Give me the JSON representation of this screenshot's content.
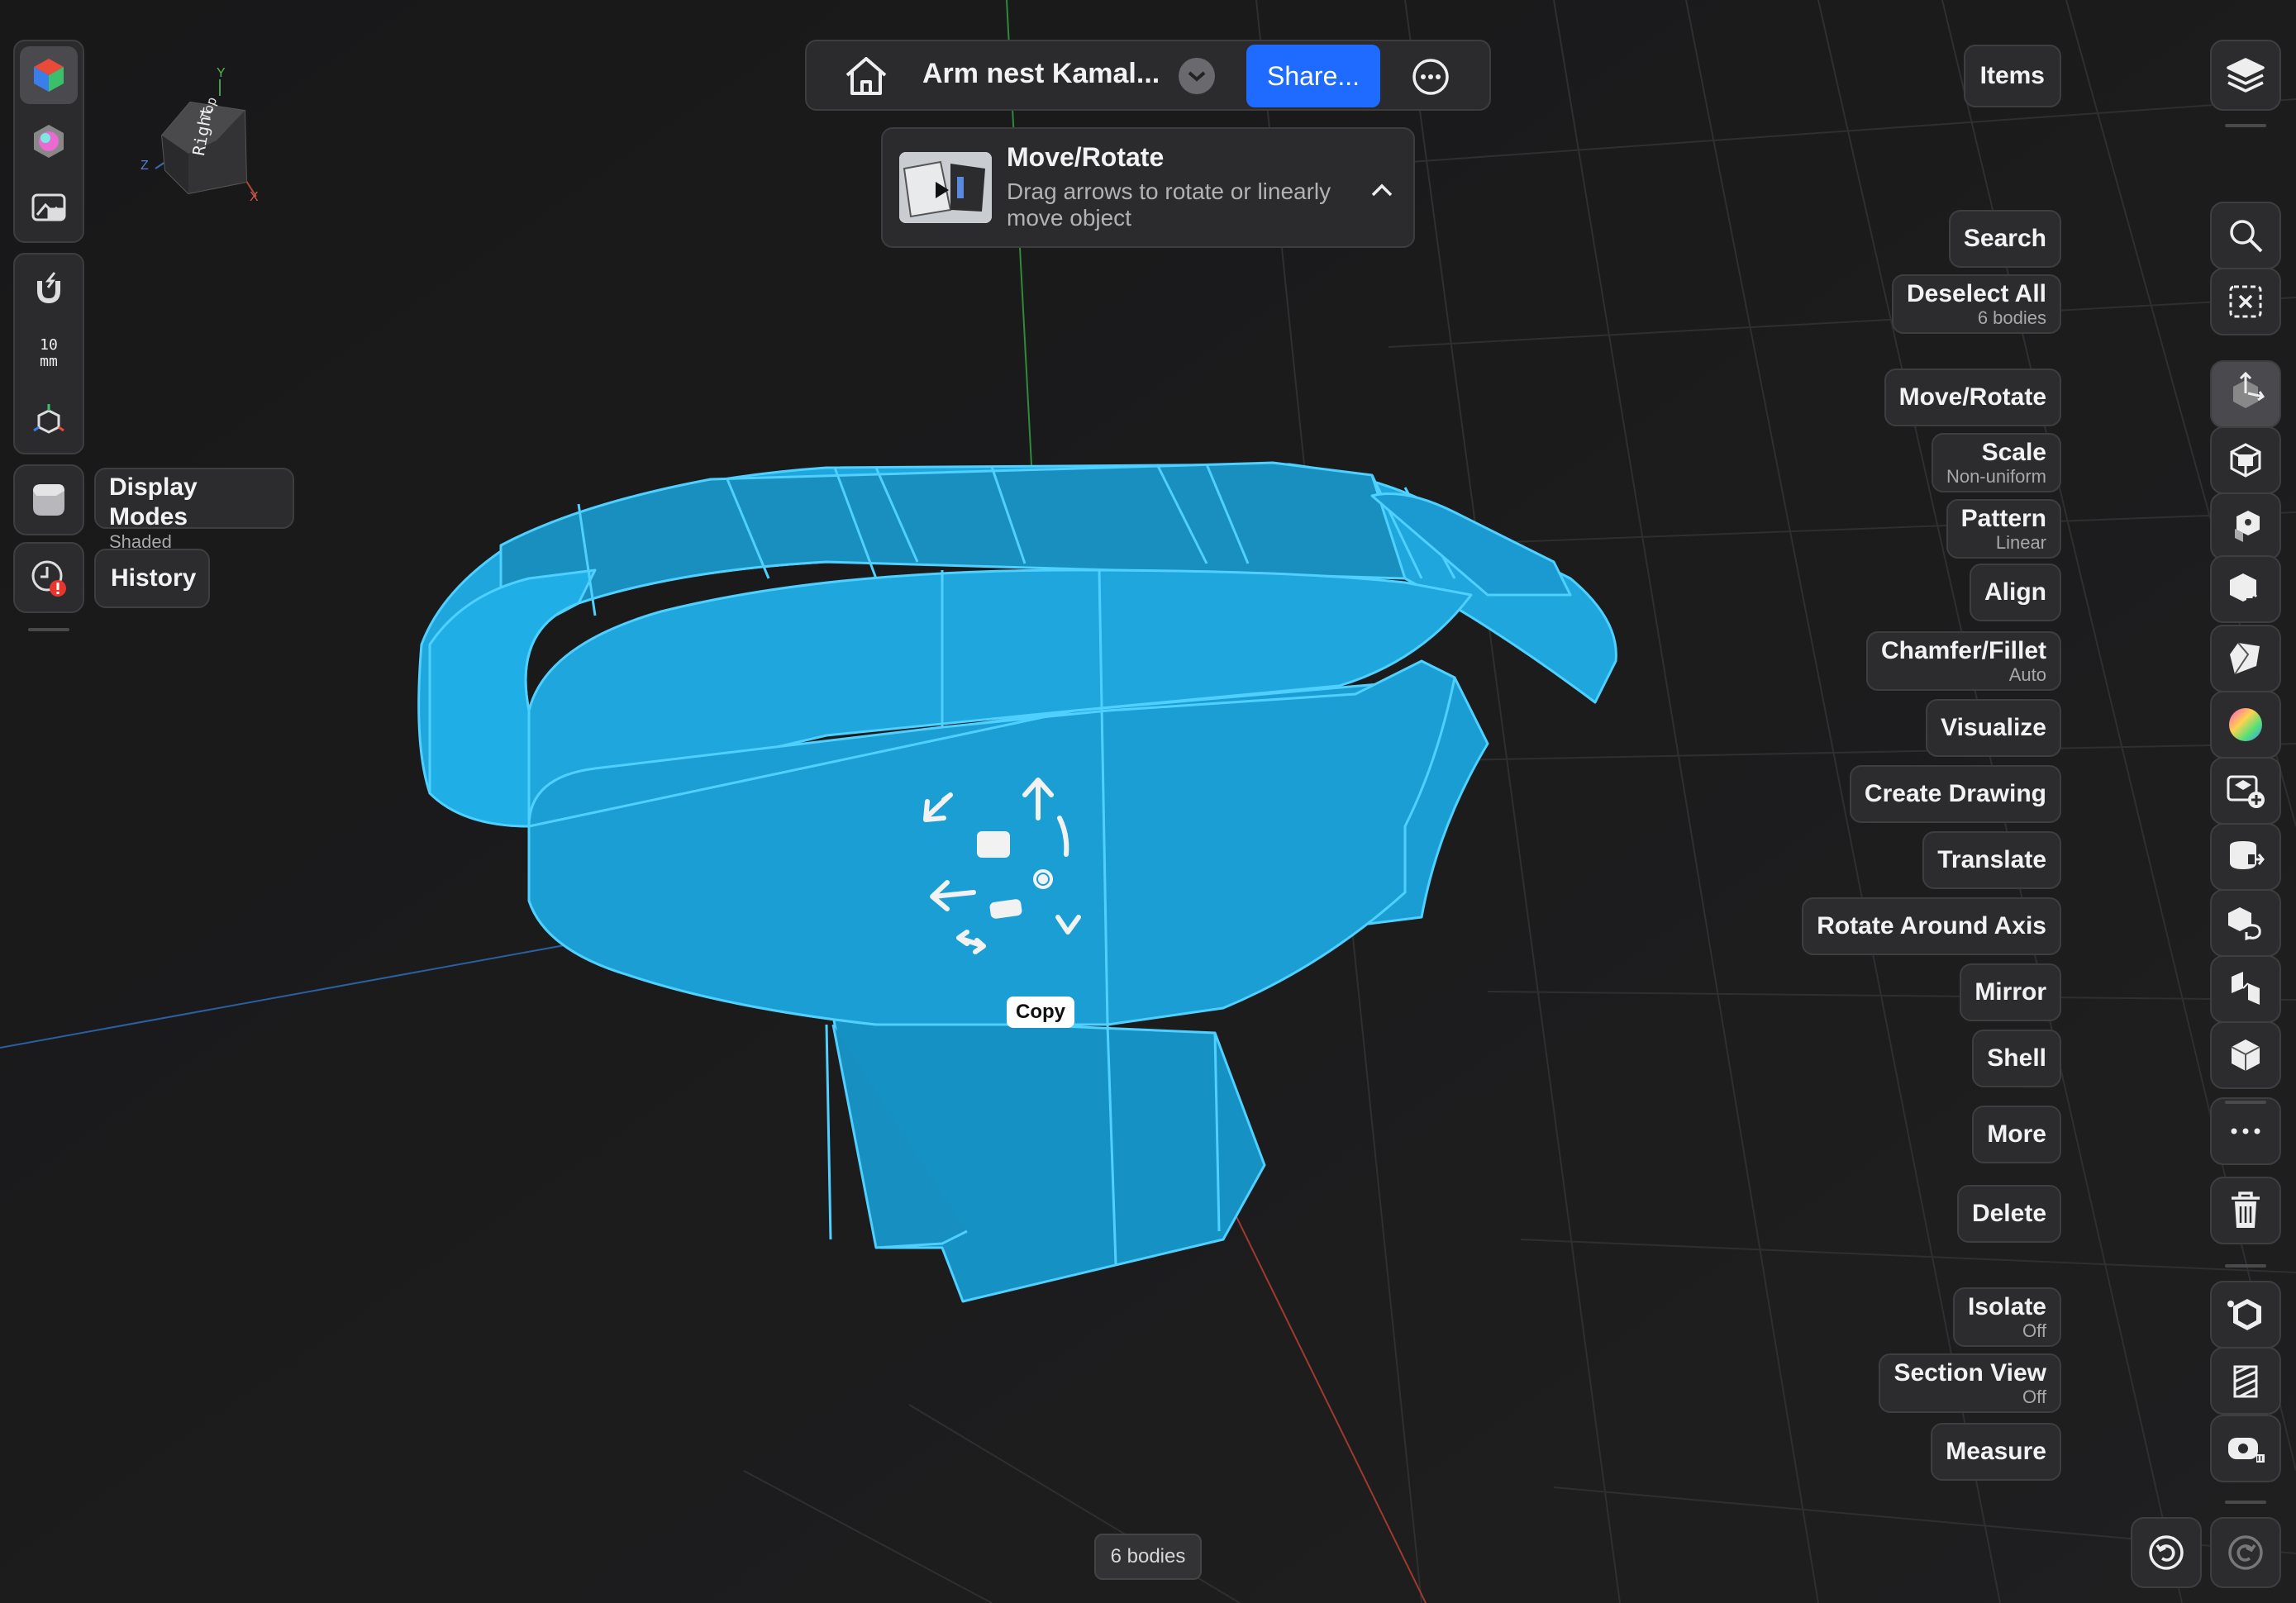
{
  "document": {
    "title": "Arm nest Kamal...",
    "share_label": "Share..."
  },
  "toast": {
    "title": "Move/Rotate",
    "text_line1": "Drag arrows to rotate or linearly",
    "text_line2": "move object"
  },
  "view_cube": {
    "face_label": "Right",
    "top_label": "Top",
    "axis_x": "X",
    "axis_y": "Y",
    "axis_z": "Z"
  },
  "left_toolbar": {
    "snap_value": "10",
    "snap_unit": "mm",
    "display_modes": {
      "label": "Display Modes",
      "sub": "Shaded"
    },
    "history": {
      "label": "History"
    }
  },
  "right_toolbar": {
    "items_label": "Items",
    "tools": [
      {
        "label": "Search",
        "sub": "",
        "icon": "search-icon"
      },
      {
        "label": "Deselect All",
        "sub": "6 bodies",
        "icon": "deselect-icon"
      },
      {
        "label": "Move/Rotate",
        "sub": "",
        "icon": "move-rotate-icon"
      },
      {
        "label": "Scale",
        "sub": "Non-uniform",
        "icon": "scale-icon"
      },
      {
        "label": "Pattern",
        "sub": "Linear",
        "icon": "pattern-icon"
      },
      {
        "label": "Align",
        "sub": "",
        "icon": "align-icon"
      },
      {
        "label": "Chamfer/Fillet",
        "sub": "Auto",
        "icon": "chamfer-icon"
      },
      {
        "label": "Visualize",
        "sub": "",
        "icon": "color-wheel-icon"
      },
      {
        "label": "Create Drawing",
        "sub": "",
        "icon": "create-drawing-icon"
      },
      {
        "label": "Translate",
        "sub": "",
        "icon": "translate-icon"
      },
      {
        "label": "Rotate Around Axis",
        "sub": "",
        "icon": "rotate-axis-icon"
      },
      {
        "label": "Mirror",
        "sub": "",
        "icon": "mirror-icon"
      },
      {
        "label": "Shell",
        "sub": "",
        "icon": "shell-icon"
      },
      {
        "label": "More",
        "sub": "",
        "icon": "more-icon"
      },
      {
        "label": "Delete",
        "sub": "",
        "icon": "trash-icon"
      },
      {
        "label": "Isolate",
        "sub": "Off",
        "icon": "isolate-icon"
      },
      {
        "label": "Section View",
        "sub": "Off",
        "icon": "section-view-icon"
      },
      {
        "label": "Measure",
        "sub": "",
        "icon": "measure-icon"
      }
    ]
  },
  "viewport": {
    "copy_label": "Copy",
    "status_text": "6 bodies",
    "model_color": "#1da6dc",
    "accent_color": "#1f6bff"
  }
}
